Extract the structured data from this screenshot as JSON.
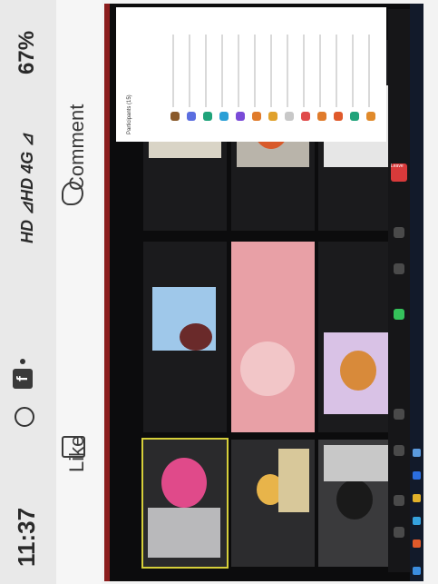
{
  "status_bar": {
    "time": "11:37",
    "network": "HD ⊿HD 4G ⊿",
    "battery": "67%",
    "icons": [
      "whatsapp-icon",
      "facebook-icon",
      "notification-dot"
    ]
  },
  "facebook": {
    "like_label": "Like",
    "comment_label": "Comment"
  },
  "meeting": {
    "panel_title": "Participants (15)",
    "leave_label": "Leave",
    "participant_colors": [
      "#8a5a2b",
      "#5b6ee0",
      "#1fa37a",
      "#2b9fd6",
      "#7a4bd8",
      "#e07b2b",
      "#e0a12b",
      "#c8c8c8",
      "#e04b4b",
      "#e07b2b",
      "#e05a2b",
      "#1fa37a",
      "#e08a2b",
      "#4b8ae0"
    ],
    "control_colors": [
      "#4a4a4a",
      "#4a4a4a",
      "#4a4a4a",
      "#35c25a",
      "#4a4a4a",
      "#4a4a4a",
      "#4a4a4a",
      "#4a4a4a"
    ]
  }
}
